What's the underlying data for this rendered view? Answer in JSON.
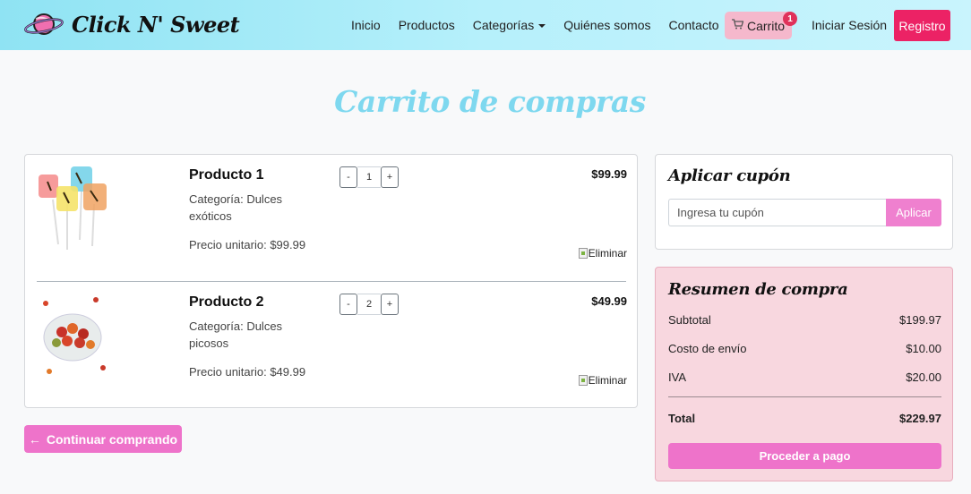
{
  "nav": {
    "brand": "Click N' Sweet",
    "links": [
      "Inicio",
      "Productos",
      "Categorías",
      "Quiénes somos",
      "Contacto"
    ],
    "cart_label": "Carrito",
    "cart_count": "1",
    "login": "Iniciar Sesión",
    "register": "Registro",
    "colors": {
      "accent": "#ec2265",
      "cart_bg": "#f5b8cc"
    }
  },
  "page": {
    "title": "Carrito de compras"
  },
  "cart": {
    "items": [
      {
        "name": "Producto 1",
        "category": "Categoría: Dulces exóticos",
        "unit_price": "Precio unitario: $99.99",
        "quantity": "1",
        "price": "$99.99",
        "remove": "Eliminar",
        "minus": "-",
        "plus": "+"
      },
      {
        "name": "Producto 2",
        "category": "Categoría: Dulces picosos",
        "unit_price": "Precio unitario: $49.99",
        "quantity": "2",
        "price": "$49.99",
        "remove": "Eliminar",
        "minus": "-",
        "plus": "+"
      }
    ],
    "continue_label": "Continuar comprando"
  },
  "coupon": {
    "heading": "Aplicar cupón",
    "placeholder": "Ingresa tu cupón",
    "apply": "Aplicar"
  },
  "summary": {
    "heading": "Resumen de compra",
    "rows": [
      {
        "label": "Subtotal",
        "value": "$199.97"
      },
      {
        "label": "Costo de envío",
        "value": "$10.00"
      },
      {
        "label": "IVA",
        "value": "$20.00"
      }
    ],
    "total_label": "Total",
    "total_value": "$229.97",
    "pay_label": "Proceder a pago",
    "colors": {
      "button": "#ee73ca",
      "background": "#f8d7df"
    }
  }
}
